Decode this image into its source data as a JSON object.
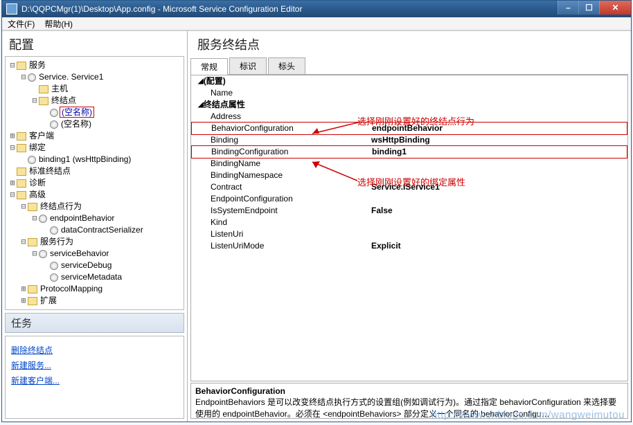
{
  "window": {
    "title": "D:\\QQPCMgr(1)\\Desktop\\App.config - Microsoft Service Configuration Editor"
  },
  "menu": {
    "file": "文件(F)",
    "help": "帮助(H)"
  },
  "left": {
    "config_head": "配置",
    "tasks_head": "任务",
    "tree": {
      "services": "服务",
      "service1": "Service. Service1",
      "host": "主机",
      "endpoints": "终结点",
      "empty1": "(空名称)",
      "empty2": "(空名称)",
      "client": "客户端",
      "binding": "绑定",
      "binding1": "binding1 (wsHttpBinding)",
      "stdEndpoints": "标准终结点",
      "diag": "诊断",
      "advanced": "高级",
      "epBehaviors": "终结点行为",
      "endpointBehavior": "endpointBehavior",
      "dataContractSerializer": "dataContractSerializer",
      "svcBehaviors": "服务行为",
      "serviceBehavior": "serviceBehavior",
      "serviceDebug": "serviceDebug",
      "serviceMetadata": "serviceMetadata",
      "protocolMapping": "ProtocolMapping",
      "extensions": "扩展"
    },
    "tasks": {
      "deleteEndpoint": "删除终结点",
      "newService": "新建服务...",
      "newClient": "新建客户端..."
    }
  },
  "right": {
    "heading": "服务终结点",
    "tabs": {
      "general": "常规",
      "identity": "标识",
      "header": "标头"
    },
    "cats": {
      "config": "(配置)",
      "epProps": "终结点属性"
    },
    "props": {
      "Name": "Name",
      "Address": "Address",
      "BehaviorConfiguration": "BehaviorConfiguration",
      "Binding": "Binding",
      "BindingConfiguration": "BindingConfiguration",
      "BindingName": "BindingName",
      "BindingNamespace": "BindingNamespace",
      "Contract": "Contract",
      "EndpointConfiguration": "EndpointConfiguration",
      "IsSystemEndpoint": "IsSystemEndpoint",
      "Kind": "Kind",
      "ListenUri": "ListenUri",
      "ListenUriMode": "ListenUriMode"
    },
    "vals": {
      "BehaviorConfiguration": "endpointBehavior",
      "Binding": "wsHttpBinding",
      "BindingConfiguration": "binding1",
      "Contract": "Service.IService1",
      "IsSystemEndpoint": "False",
      "ListenUriMode": "Explicit"
    },
    "annot1": "选择刚刚设置好的终结点行为",
    "annot2": "选择刚刚设置好的绑定属性",
    "help": {
      "name": "BehaviorConfiguration",
      "desc": "EndpointBehaviors 是可以改变终结点执行方式的设置组(例如调试行为)。通过指定 behaviorConfiguration 来选择要使用的 endpointBehavior。必须在 <endpointBehaviors> 部分定义一个同名的 behaviorConfigu…"
    }
  },
  "watermark": "http://www.cnblogs.com/wangweimutou"
}
